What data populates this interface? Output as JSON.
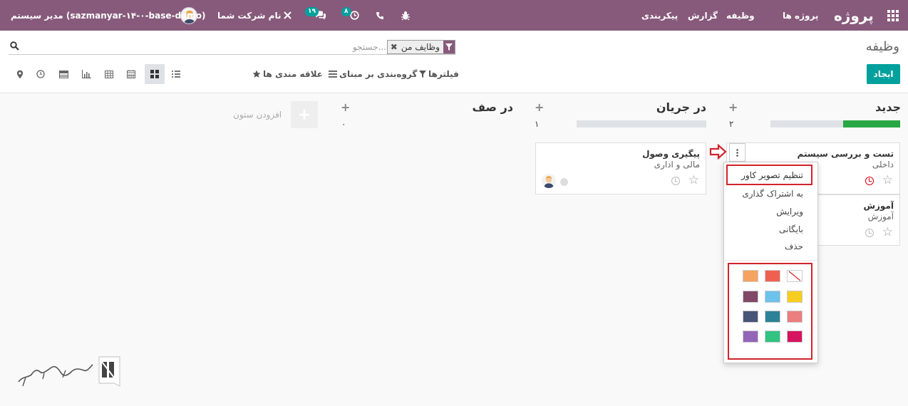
{
  "navbar": {
    "brand": "پروژه",
    "menu": [
      "پروژه ها",
      "وظیفه",
      "گزارش",
      "پیکربندی"
    ],
    "company": "نام شرکت شما",
    "user": "مدیر سیستم (sazmanyar-۱۴-۰-base-demo)",
    "chat_badge": "۱۹",
    "activity_badge": "۸",
    "color": "#875a7b"
  },
  "control_panel": {
    "title": "وظیفه",
    "search_placeholder": "جستجو...",
    "facet": "وظایف من",
    "create_label": "ایجاد",
    "filters_label": "فیلترها",
    "groupby_label": "گروه‌بندی بر مبنای",
    "favorites_label": "علاقه مندی ها",
    "views": [
      "kanban-icon",
      "list-icon",
      "calendar-icon",
      "pivot-icon",
      "graph-icon",
      "cohort-icon",
      "activity-icon",
      "map-icon"
    ]
  },
  "kanban": {
    "columns": [
      {
        "title": "جدید",
        "count": "۲",
        "progress_fraction": 0.44
      },
      {
        "title": "در جریان",
        "count": "۱",
        "progress_fraction": 0
      },
      {
        "title": "در صف",
        "count": "۰"
      }
    ],
    "add_column_label": "افزودن ستون",
    "cards": [
      {
        "title": "تست و بررسی سیستم",
        "subtitle": "داخلی"
      },
      {
        "title": "آموزش",
        "subtitle": "آموزش"
      },
      {
        "title": "پیگیری وصول",
        "subtitle": "مالی و اداری"
      }
    ]
  },
  "dropdown": {
    "items": [
      "تنظیم تصویر کاور",
      "به اشتراک گذاری",
      "ویرایش",
      "بایگانی",
      "حذف"
    ],
    "colors": [
      [
        "#ffffff",
        "#f06050",
        "#f4a460"
      ],
      [
        "#f7cd1f",
        "#6cc1ed",
        "#814968"
      ],
      [
        "#eb7e7f",
        "#2c8397",
        "#475577"
      ],
      [
        "#d6145f",
        "#30c381",
        "#9365b8"
      ]
    ]
  },
  "accent_color": "#00a09d",
  "highlight_color": "#d3232d"
}
